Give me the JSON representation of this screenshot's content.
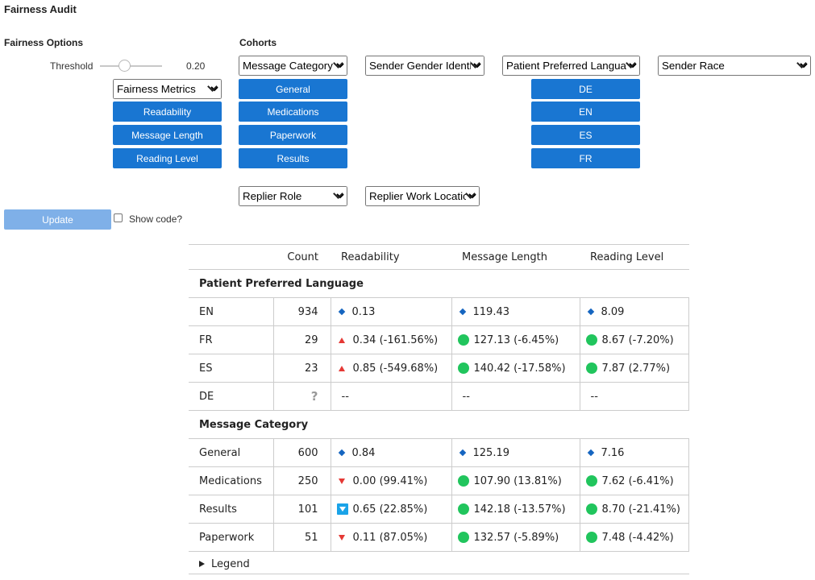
{
  "app": {
    "title": "Fairness Audit"
  },
  "options": {
    "heading": "Fairness Options",
    "threshold_label": "Threshold",
    "threshold_value": "0.20",
    "threshold_fraction": 0.2,
    "metric_select": "Fairness Metrics",
    "metric_buttons": [
      "Readability",
      "Message Length",
      "Reading Level"
    ]
  },
  "cohorts": {
    "heading": "Cohorts",
    "selects": {
      "message_category": "Message Category",
      "sender_gender": "Sender Gender Identity",
      "patient_language": "Patient Preferred Language",
      "sender_race": "Sender Race",
      "replier_role": "Replier Role",
      "replier_location": "Replier Work Location"
    },
    "category_buttons": [
      "General",
      "Medications",
      "Paperwork",
      "Results"
    ],
    "language_buttons": [
      "DE",
      "EN",
      "ES",
      "FR"
    ]
  },
  "actions": {
    "update": "Update",
    "show_code": "Show code?"
  },
  "table": {
    "headers": [
      "",
      "Count",
      "Readability",
      "Message Length",
      "Reading Level"
    ],
    "groups": [
      {
        "name": "Patient Preferred Language",
        "rows": [
          {
            "label": "EN",
            "count": "934",
            "readability": {
              "icon": "diamond",
              "text": "0.13"
            },
            "length": {
              "icon": "diamond",
              "text": "119.43"
            },
            "level": {
              "icon": "diamond",
              "text": "8.09"
            }
          },
          {
            "label": "FR",
            "count": "29",
            "readability": {
              "icon": "up",
              "text": "0.34 (-161.56%)"
            },
            "length": {
              "icon": "dot",
              "text": "127.13 (-6.45%)"
            },
            "level": {
              "icon": "dot",
              "text": "8.67 (-7.20%)"
            }
          },
          {
            "label": "ES",
            "count": "23",
            "readability": {
              "icon": "up",
              "text": "0.85 (-549.68%)"
            },
            "length": {
              "icon": "dot",
              "text": "140.42 (-17.58%)"
            },
            "level": {
              "icon": "dot",
              "text": "7.87 (2.77%)"
            }
          },
          {
            "label": "DE",
            "count": "?",
            "readability": {
              "icon": "none",
              "text": "--"
            },
            "length": {
              "icon": "none",
              "text": "--"
            },
            "level": {
              "icon": "none",
              "text": "--"
            }
          }
        ]
      },
      {
        "name": "Message Category",
        "rows": [
          {
            "label": "General",
            "count": "600",
            "readability": {
              "icon": "diamond",
              "text": "0.84"
            },
            "length": {
              "icon": "diamond",
              "text": "125.19"
            },
            "level": {
              "icon": "diamond",
              "text": "7.16"
            }
          },
          {
            "label": "Medications",
            "count": "250",
            "readability": {
              "icon": "down",
              "text": "0.00 (99.41%)"
            },
            "length": {
              "icon": "dot",
              "text": "107.90 (13.81%)"
            },
            "level": {
              "icon": "dot",
              "text": "7.62 (-6.41%)"
            }
          },
          {
            "label": "Results",
            "count": "101",
            "readability": {
              "icon": "boxdown",
              "text": "0.65 (22.85%)"
            },
            "length": {
              "icon": "dot",
              "text": "142.18 (-13.57%)"
            },
            "level": {
              "icon": "dot",
              "text": "8.70 (-21.41%)"
            }
          },
          {
            "label": "Paperwork",
            "count": "51",
            "readability": {
              "icon": "down",
              "text": "0.11 (87.05%)"
            },
            "length": {
              "icon": "dot",
              "text": "132.57 (-5.89%)"
            },
            "level": {
              "icon": "dot",
              "text": "7.48 (-4.42%)"
            }
          }
        ]
      }
    ],
    "legend": "Legend"
  },
  "colors": {
    "button": "#1976d2",
    "button_disabled": "#7fb0e8",
    "good": "#21c55d",
    "bad": "#e53935",
    "neutral": "#1565c0"
  }
}
